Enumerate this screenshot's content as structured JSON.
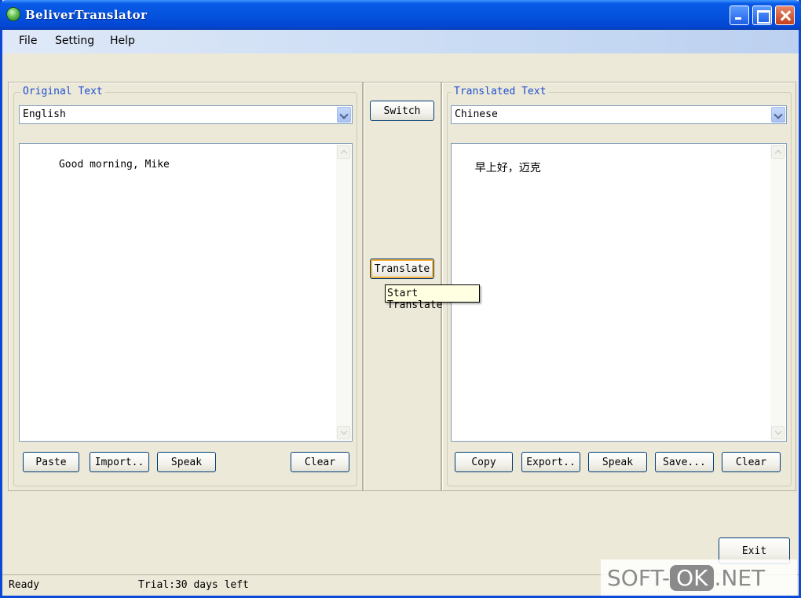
{
  "window": {
    "title": "BeliverTranslator"
  },
  "menu": {
    "file": "File",
    "setting": "Setting",
    "help": "Help"
  },
  "left": {
    "legend": "Original Text",
    "language": "English",
    "text": "Good morning, Mike",
    "buttons": {
      "paste": "Paste",
      "import": "Import..",
      "speak": "Speak",
      "clear": "Clear"
    }
  },
  "middle": {
    "switch": "Switch",
    "translate": "Translate",
    "tooltip": "Start Translate"
  },
  "right": {
    "legend": "Translated Text",
    "language": "Chinese",
    "text": "早上好，迈克",
    "buttons": {
      "copy": "Copy",
      "export": "Export..",
      "speak": "Speak",
      "save": "Save...",
      "clear": "Clear"
    }
  },
  "footer": {
    "exit": "Exit"
  },
  "status": {
    "state": "Ready",
    "trial": "Trial:30 days left"
  },
  "watermark": {
    "prefix": "SOFT-",
    "ok": "OK",
    "suffix": ".NET"
  },
  "colors": {
    "titlebar": "#0453de",
    "legend_text": "#1e4fd1",
    "window_bg": "#ece9d8"
  },
  "icons": {
    "app": "globe-icon",
    "minimize": "minimize-icon",
    "maximize": "maximize-icon",
    "close": "close-icon"
  }
}
